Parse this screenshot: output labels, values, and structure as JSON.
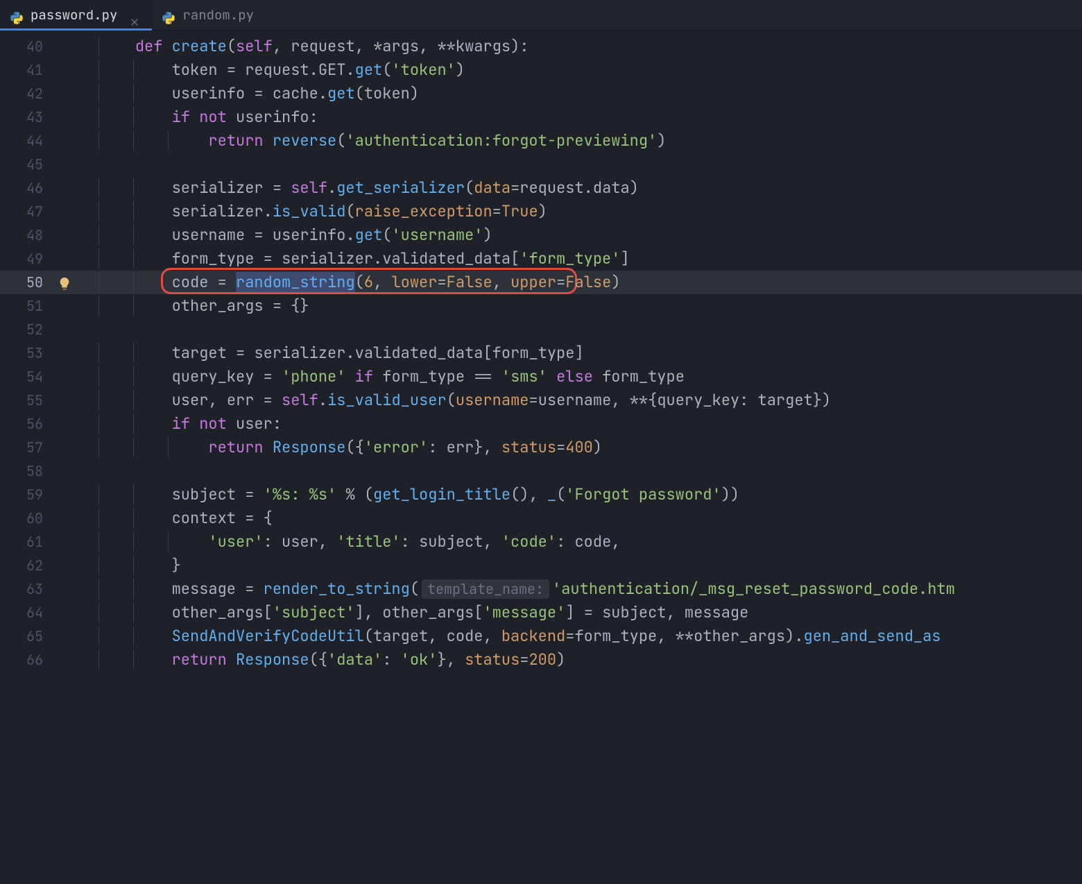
{
  "tabs": [
    {
      "label": "password.py",
      "active": true
    },
    {
      "label": "random.py",
      "active": false
    }
  ],
  "hint_line": 50,
  "highlight_line": 50,
  "red_box": {
    "line": 50,
    "contains": "code = random_string(6, lower=False, upper=False)"
  },
  "selection": {
    "line": 50,
    "text": "random_string"
  },
  "param_hint": {
    "line": 63,
    "text": "template_name:"
  },
  "lines": [
    {
      "n": 40,
      "indent": 1,
      "tokens": [
        [
          "kw",
          "def "
        ],
        [
          "fncall",
          "create"
        ],
        [
          "punc",
          "("
        ],
        [
          "self",
          "self"
        ],
        [
          "punc",
          ", "
        ],
        [
          "plain",
          "request"
        ],
        [
          "punc",
          ", "
        ],
        [
          "op",
          "*"
        ],
        [
          "plain",
          "args"
        ],
        [
          "punc",
          ", "
        ],
        [
          "op",
          "**"
        ],
        [
          "plain",
          "kwargs"
        ],
        [
          "punc",
          "):"
        ]
      ]
    },
    {
      "n": 41,
      "indent": 2,
      "tokens": [
        [
          "plain",
          "token "
        ],
        [
          "op",
          "="
        ],
        [
          "plain",
          " request"
        ],
        [
          "punc",
          "."
        ],
        [
          "plain",
          "GET"
        ],
        [
          "punc",
          "."
        ],
        [
          "fncall",
          "get"
        ],
        [
          "punc",
          "("
        ],
        [
          "str",
          "'token'"
        ],
        [
          "punc",
          ")"
        ]
      ]
    },
    {
      "n": 42,
      "indent": 2,
      "tokens": [
        [
          "plain",
          "userinfo "
        ],
        [
          "op",
          "="
        ],
        [
          "plain",
          " cache"
        ],
        [
          "punc",
          "."
        ],
        [
          "fncall",
          "get"
        ],
        [
          "punc",
          "("
        ],
        [
          "plain",
          "token"
        ],
        [
          "punc",
          ")"
        ]
      ]
    },
    {
      "n": 43,
      "indent": 2,
      "tokens": [
        [
          "kw",
          "if "
        ],
        [
          "kw",
          "not "
        ],
        [
          "plain",
          "userinfo"
        ],
        [
          "punc",
          ":"
        ]
      ]
    },
    {
      "n": 44,
      "indent": 3,
      "tokens": [
        [
          "kw",
          "return "
        ],
        [
          "fncall",
          "reverse"
        ],
        [
          "punc",
          "("
        ],
        [
          "str",
          "'authentication:forgot-previewing'"
        ],
        [
          "punc",
          ")"
        ]
      ]
    },
    {
      "n": 45,
      "indent": 0,
      "tokens": []
    },
    {
      "n": 46,
      "indent": 2,
      "tokens": [
        [
          "plain",
          "serializer "
        ],
        [
          "op",
          "="
        ],
        [
          "plain",
          " "
        ],
        [
          "self",
          "self"
        ],
        [
          "punc",
          "."
        ],
        [
          "fncall",
          "get_serializer"
        ],
        [
          "punc",
          "("
        ],
        [
          "param",
          "data"
        ],
        [
          "op",
          "="
        ],
        [
          "plain",
          "request"
        ],
        [
          "punc",
          "."
        ],
        [
          "plain",
          "data"
        ],
        [
          "punc",
          ")"
        ]
      ]
    },
    {
      "n": 47,
      "indent": 2,
      "tokens": [
        [
          "plain",
          "serializer"
        ],
        [
          "punc",
          "."
        ],
        [
          "fncall",
          "is_valid"
        ],
        [
          "punc",
          "("
        ],
        [
          "param",
          "raise_exception"
        ],
        [
          "op",
          "="
        ],
        [
          "const",
          "True"
        ],
        [
          "punc",
          ")"
        ]
      ]
    },
    {
      "n": 48,
      "indent": 2,
      "tokens": [
        [
          "plain",
          "username "
        ],
        [
          "op",
          "="
        ],
        [
          "plain",
          " userinfo"
        ],
        [
          "punc",
          "."
        ],
        [
          "fncall",
          "get"
        ],
        [
          "punc",
          "("
        ],
        [
          "str",
          "'username'"
        ],
        [
          "punc",
          ")"
        ]
      ]
    },
    {
      "n": 49,
      "indent": 2,
      "tokens": [
        [
          "plain",
          "form_type "
        ],
        [
          "op",
          "="
        ],
        [
          "plain",
          " serializer"
        ],
        [
          "punc",
          "."
        ],
        [
          "plain",
          "validated_data"
        ],
        [
          "punc",
          "["
        ],
        [
          "str",
          "'form_type'"
        ],
        [
          "punc",
          "]"
        ]
      ]
    },
    {
      "n": 50,
      "indent": 2,
      "tokens": [
        [
          "plain",
          "code "
        ],
        [
          "op",
          "="
        ],
        [
          "plain",
          " "
        ],
        [
          "sel",
          "random_string"
        ],
        [
          "punc",
          "("
        ],
        [
          "num",
          "6"
        ],
        [
          "punc",
          ", "
        ],
        [
          "param",
          "lower"
        ],
        [
          "op",
          "="
        ],
        [
          "const",
          "False"
        ],
        [
          "punc",
          ", "
        ],
        [
          "param",
          "upper"
        ],
        [
          "op",
          "="
        ],
        [
          "const",
          "False"
        ],
        [
          "punc",
          ")"
        ]
      ]
    },
    {
      "n": 51,
      "indent": 2,
      "tokens": [
        [
          "plain",
          "other_args "
        ],
        [
          "op",
          "="
        ],
        [
          "plain",
          " "
        ],
        [
          "punc",
          "{}"
        ]
      ]
    },
    {
      "n": 52,
      "indent": 0,
      "tokens": []
    },
    {
      "n": 53,
      "indent": 2,
      "tokens": [
        [
          "plain",
          "target "
        ],
        [
          "op",
          "="
        ],
        [
          "plain",
          " serializer"
        ],
        [
          "punc",
          "."
        ],
        [
          "plain",
          "validated_data"
        ],
        [
          "punc",
          "["
        ],
        [
          "plain",
          "form_type"
        ],
        [
          "punc",
          "]"
        ]
      ]
    },
    {
      "n": 54,
      "indent": 2,
      "tokens": [
        [
          "plain",
          "query_key "
        ],
        [
          "op",
          "="
        ],
        [
          "plain",
          " "
        ],
        [
          "str",
          "'phone'"
        ],
        [
          "plain",
          " "
        ],
        [
          "kw",
          "if "
        ],
        [
          "plain",
          "form_type "
        ],
        [
          "op",
          "=="
        ],
        [
          "plain",
          " "
        ],
        [
          "str",
          "'sms'"
        ],
        [
          "plain",
          " "
        ],
        [
          "kw",
          "else "
        ],
        [
          "plain",
          "form_type"
        ]
      ]
    },
    {
      "n": 55,
      "indent": 2,
      "tokens": [
        [
          "plain",
          "user"
        ],
        [
          "punc",
          ", "
        ],
        [
          "plain",
          "err "
        ],
        [
          "op",
          "="
        ],
        [
          "plain",
          " "
        ],
        [
          "self",
          "self"
        ],
        [
          "punc",
          "."
        ],
        [
          "fncall",
          "is_valid_user"
        ],
        [
          "punc",
          "("
        ],
        [
          "param",
          "username"
        ],
        [
          "op",
          "="
        ],
        [
          "plain",
          "username"
        ],
        [
          "punc",
          ", "
        ],
        [
          "op",
          "**"
        ],
        [
          "punc",
          "{"
        ],
        [
          "plain",
          "query_key"
        ],
        [
          "punc",
          ": "
        ],
        [
          "plain",
          "target"
        ],
        [
          "punc",
          "})"
        ]
      ]
    },
    {
      "n": 56,
      "indent": 2,
      "tokens": [
        [
          "kw",
          "if "
        ],
        [
          "kw",
          "not "
        ],
        [
          "plain",
          "user"
        ],
        [
          "punc",
          ":"
        ]
      ]
    },
    {
      "n": 57,
      "indent": 3,
      "tokens": [
        [
          "kw",
          "return "
        ],
        [
          "fncall",
          "Response"
        ],
        [
          "punc",
          "({"
        ],
        [
          "str",
          "'error'"
        ],
        [
          "punc",
          ": "
        ],
        [
          "plain",
          "err"
        ],
        [
          "punc",
          "}, "
        ],
        [
          "param",
          "status"
        ],
        [
          "op",
          "="
        ],
        [
          "num",
          "400"
        ],
        [
          "punc",
          ")"
        ]
      ]
    },
    {
      "n": 58,
      "indent": 0,
      "tokens": []
    },
    {
      "n": 59,
      "indent": 2,
      "tokens": [
        [
          "plain",
          "subject "
        ],
        [
          "op",
          "="
        ],
        [
          "plain",
          " "
        ],
        [
          "str",
          "'%s: %s'"
        ],
        [
          "plain",
          " "
        ],
        [
          "op",
          "%"
        ],
        [
          "plain",
          " "
        ],
        [
          "punc",
          "("
        ],
        [
          "fncall",
          "get_login_title"
        ],
        [
          "punc",
          "(), "
        ],
        [
          "fncall",
          "_"
        ],
        [
          "punc",
          "("
        ],
        [
          "str",
          "'Forgot password'"
        ],
        [
          "punc",
          "))"
        ]
      ]
    },
    {
      "n": 60,
      "indent": 2,
      "tokens": [
        [
          "plain",
          "context "
        ],
        [
          "op",
          "="
        ],
        [
          "plain",
          " "
        ],
        [
          "punc",
          "{"
        ]
      ]
    },
    {
      "n": 61,
      "indent": 3,
      "tokens": [
        [
          "str",
          "'user'"
        ],
        [
          "punc",
          ": "
        ],
        [
          "plain",
          "user"
        ],
        [
          "punc",
          ", "
        ],
        [
          "str",
          "'title'"
        ],
        [
          "punc",
          ": "
        ],
        [
          "plain",
          "subject"
        ],
        [
          "punc",
          ", "
        ],
        [
          "str",
          "'code'"
        ],
        [
          "punc",
          ": "
        ],
        [
          "plain",
          "code"
        ],
        [
          "punc",
          ","
        ]
      ]
    },
    {
      "n": 62,
      "indent": 2,
      "tokens": [
        [
          "punc",
          "}"
        ]
      ]
    },
    {
      "n": 63,
      "indent": 2,
      "tokens": [
        [
          "plain",
          "message "
        ],
        [
          "op",
          "="
        ],
        [
          "plain",
          " "
        ],
        [
          "fncall",
          "render_to_string"
        ],
        [
          "punc",
          "("
        ],
        [
          "hint",
          "template_name:"
        ],
        [
          "str",
          "'authentication/_msg_reset_password_code.htm"
        ]
      ]
    },
    {
      "n": 64,
      "indent": 2,
      "tokens": [
        [
          "plain",
          "other_args"
        ],
        [
          "punc",
          "["
        ],
        [
          "str",
          "'subject'"
        ],
        [
          "punc",
          "], "
        ],
        [
          "plain",
          "other_args"
        ],
        [
          "punc",
          "["
        ],
        [
          "str",
          "'message'"
        ],
        [
          "punc",
          "] "
        ],
        [
          "op",
          "="
        ],
        [
          "plain",
          " subject"
        ],
        [
          "punc",
          ", "
        ],
        [
          "plain",
          "message"
        ]
      ]
    },
    {
      "n": 65,
      "indent": 2,
      "tokens": [
        [
          "fncall",
          "SendAndVerifyCodeUtil"
        ],
        [
          "punc",
          "("
        ],
        [
          "plain",
          "target"
        ],
        [
          "punc",
          ", "
        ],
        [
          "plain",
          "code"
        ],
        [
          "punc",
          ", "
        ],
        [
          "param",
          "backend"
        ],
        [
          "op",
          "="
        ],
        [
          "plain",
          "form_type"
        ],
        [
          "punc",
          ", "
        ],
        [
          "op",
          "**"
        ],
        [
          "plain",
          "other_args"
        ],
        [
          "punc",
          ")."
        ],
        [
          "fncall",
          "gen_and_send_as"
        ]
      ]
    },
    {
      "n": 66,
      "indent": 2,
      "tokens": [
        [
          "kw",
          "return "
        ],
        [
          "fncall",
          "Response"
        ],
        [
          "punc",
          "({"
        ],
        [
          "str",
          "'data'"
        ],
        [
          "punc",
          ": "
        ],
        [
          "str",
          "'ok'"
        ],
        [
          "punc",
          "}, "
        ],
        [
          "param",
          "status"
        ],
        [
          "op",
          "="
        ],
        [
          "num",
          "200"
        ],
        [
          "punc",
          ")"
        ]
      ]
    }
  ]
}
